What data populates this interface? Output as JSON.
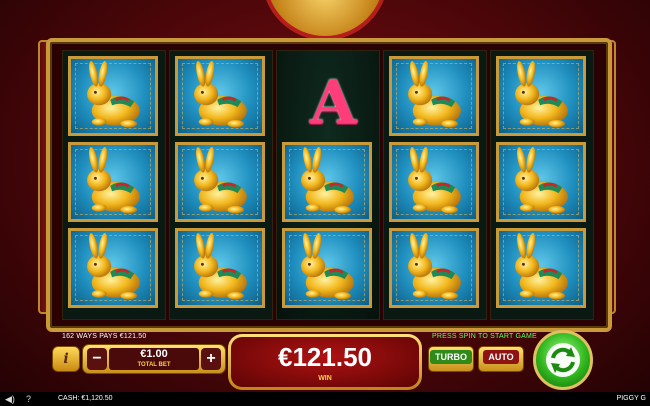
{
  "reels": [
    [
      "rabbit",
      "rabbit",
      "rabbit"
    ],
    [
      "rabbit",
      "rabbit",
      "rabbit"
    ],
    [
      "A",
      "rabbit",
      "rabbit"
    ],
    [
      "rabbit",
      "rabbit",
      "rabbit"
    ],
    [
      "rabbit",
      "rabbit",
      "rabbit"
    ]
  ],
  "symbols": {
    "letter_a": "A"
  },
  "ways_text": "162 WAYS PAYS €121.50",
  "press_spin_text": "PRESS SPIN TO START GAME",
  "info_label": "i",
  "bet": {
    "minus": "−",
    "value": "€1.00",
    "label": "TOTAL BET",
    "plus": "+"
  },
  "win": {
    "value": "€121.50",
    "label": "WIN"
  },
  "turbo_label": "TURBO",
  "auto_label": "AUTO",
  "footer": {
    "cash": "CASH: €1,120.50",
    "game_name": "PIGGY G"
  },
  "icons": {
    "sound": "speaker-icon",
    "help": "question-icon",
    "spin": "spin-arrows-icon"
  },
  "colors": {
    "gold": "#c99a3a",
    "win_red": "#b01212",
    "spin_green": "#2fb51e",
    "letter_a": "#ff3d7a"
  }
}
